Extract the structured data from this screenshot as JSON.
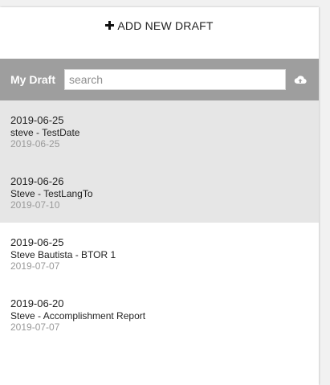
{
  "add_button": {
    "label": "ADD NEW DRAFT",
    "icon": "plus-icon"
  },
  "header": {
    "title": "My Draft",
    "search_placeholder": "search",
    "search_value": "",
    "upload_icon": "cloud-upload-icon",
    "bg_color": "#9e9e9e"
  },
  "drafts": [
    {
      "date": "2019-06-25",
      "name": "steve - TestDate",
      "sub_date": "2019-06-25",
      "shaded": true
    },
    {
      "date": "2019-06-26",
      "name": "Steve - TestLangTo",
      "sub_date": "2019-07-10",
      "shaded": true
    },
    {
      "date": "2019-06-25",
      "name": "Steve Bautista - BTOR 1",
      "sub_date": "2019-07-07",
      "shaded": false
    },
    {
      "date": "2019-06-20",
      "name": "Steve - Accomplishment Report",
      "sub_date": "2019-07-07",
      "shaded": false
    }
  ]
}
